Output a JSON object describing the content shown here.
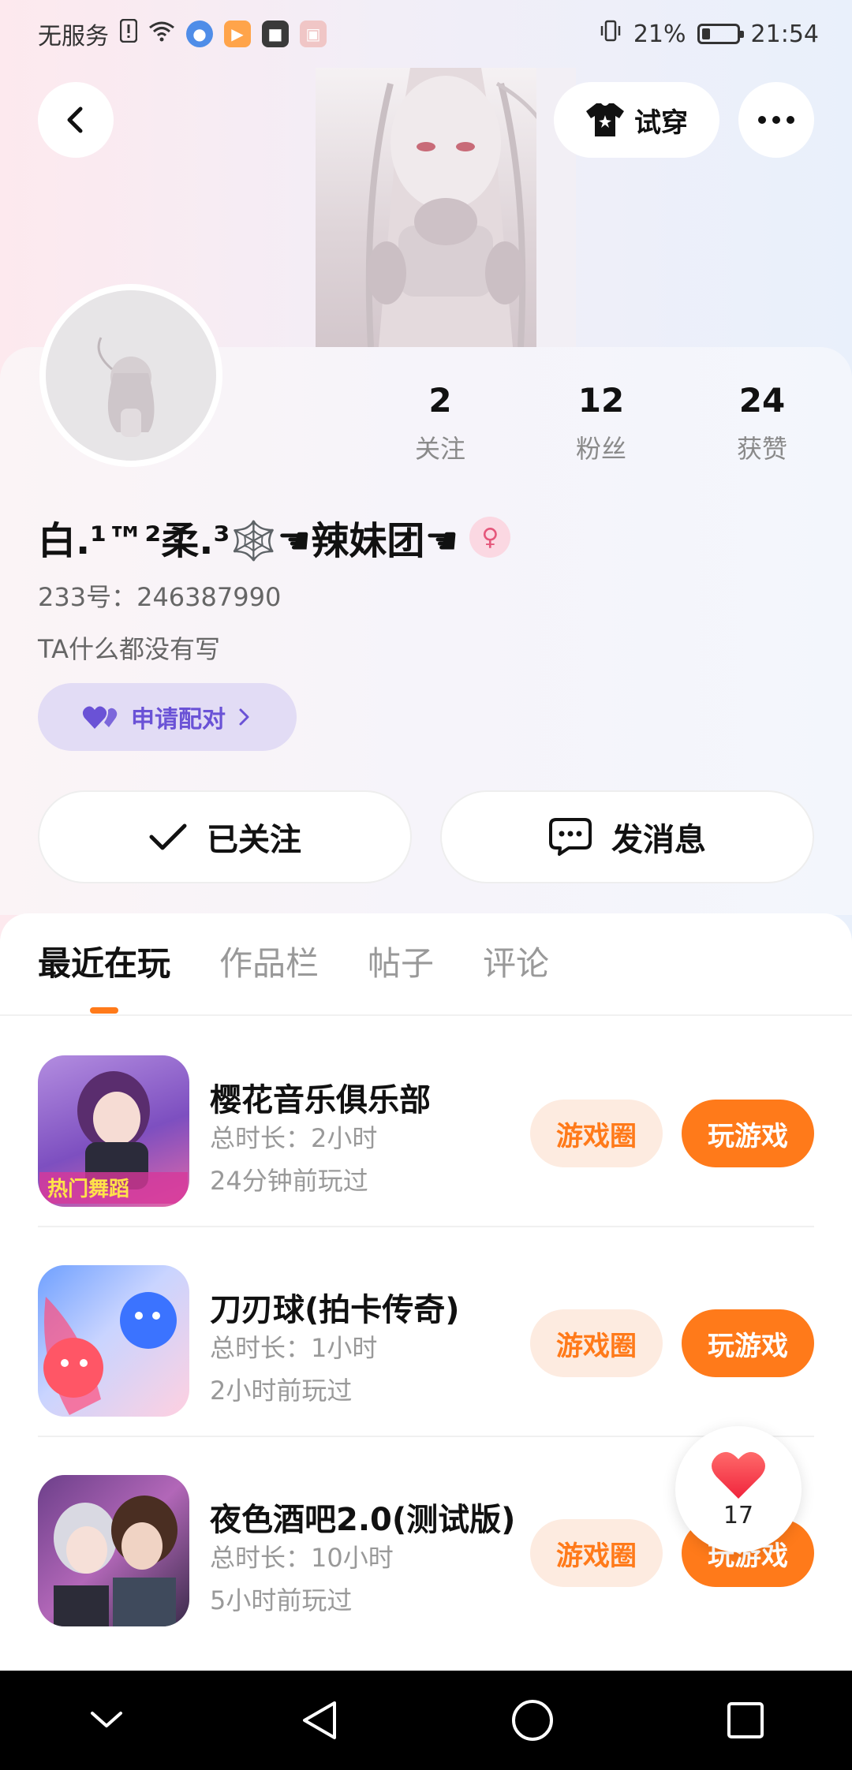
{
  "status_bar": {
    "carrier": "无服务",
    "battery_percent": "21%",
    "battery_level": 0.21,
    "time": "21:54"
  },
  "header": {
    "tryon_label": "试穿"
  },
  "profile": {
    "stats": [
      {
        "value": "2",
        "label": "关注"
      },
      {
        "value": "12",
        "label": "粉丝"
      },
      {
        "value": "24",
        "label": "获赞"
      }
    ],
    "username": "白.¹™²柔.³🕸️☚辣妹团☚",
    "gender_icon": "♀",
    "uid_text": "233号：246387990",
    "bio": "TA什么都没有写",
    "pair_button": "申请配对",
    "follow_button": "已关注",
    "message_button": "发消息"
  },
  "tabs": [
    {
      "label": "最近在玩",
      "active": true
    },
    {
      "label": "作品栏",
      "active": false
    },
    {
      "label": "帖子",
      "active": false
    },
    {
      "label": "评论",
      "active": false
    }
  ],
  "games": [
    {
      "title": "樱花音乐俱乐部",
      "total_time": "总时长：2小时",
      "last_played": "24分钟前玩过",
      "icon_text": "热门舞蹈",
      "circle_label": "游戏圈",
      "play_label": "玩游戏"
    },
    {
      "title": "刀刃球(拍卡传奇)",
      "total_time": "总时长：1小时",
      "last_played": "2小时前玩过",
      "icon_text": "",
      "circle_label": "游戏圈",
      "play_label": "玩游戏"
    },
    {
      "title": "夜色酒吧2.0(测试版)",
      "total_time": "总时长：10小时",
      "last_played": "5小时前玩过",
      "icon_text": "",
      "circle_label": "游戏圈",
      "play_label": "玩游戏"
    }
  ],
  "like_float": {
    "count": "17"
  },
  "colors": {
    "accent": "#ff7a1a",
    "pair_purple": "#6a52d6"
  }
}
